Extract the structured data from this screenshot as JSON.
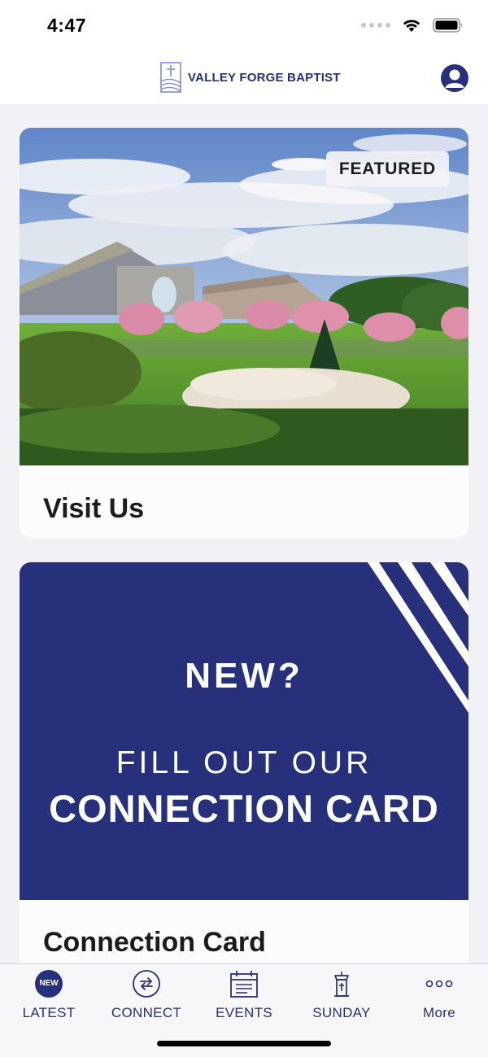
{
  "status_bar": {
    "time": "4:47"
  },
  "header": {
    "logo_text": "VALLEY FORGE BAPTIST"
  },
  "cards": [
    {
      "badge": "FEATURED",
      "title": "Visit Us",
      "image": "church-building-photo"
    },
    {
      "title": "Connection Card",
      "promo": {
        "line1": "NEW?",
        "line2": "FILL OUT OUR",
        "line3": "CONNECTION CARD"
      }
    }
  ],
  "tabs": [
    {
      "label": "LATEST",
      "icon": "new-badge-icon",
      "badge": "NEW"
    },
    {
      "label": "CONNECT",
      "icon": "connect-arrows-icon"
    },
    {
      "label": "EVENTS",
      "icon": "calendar-icon"
    },
    {
      "label": "SUNDAY",
      "icon": "pulpit-icon"
    },
    {
      "label": "More",
      "icon": "more-dots-icon"
    }
  ],
  "colors": {
    "brand": "#26307b",
    "background": "#f2f2f6"
  }
}
